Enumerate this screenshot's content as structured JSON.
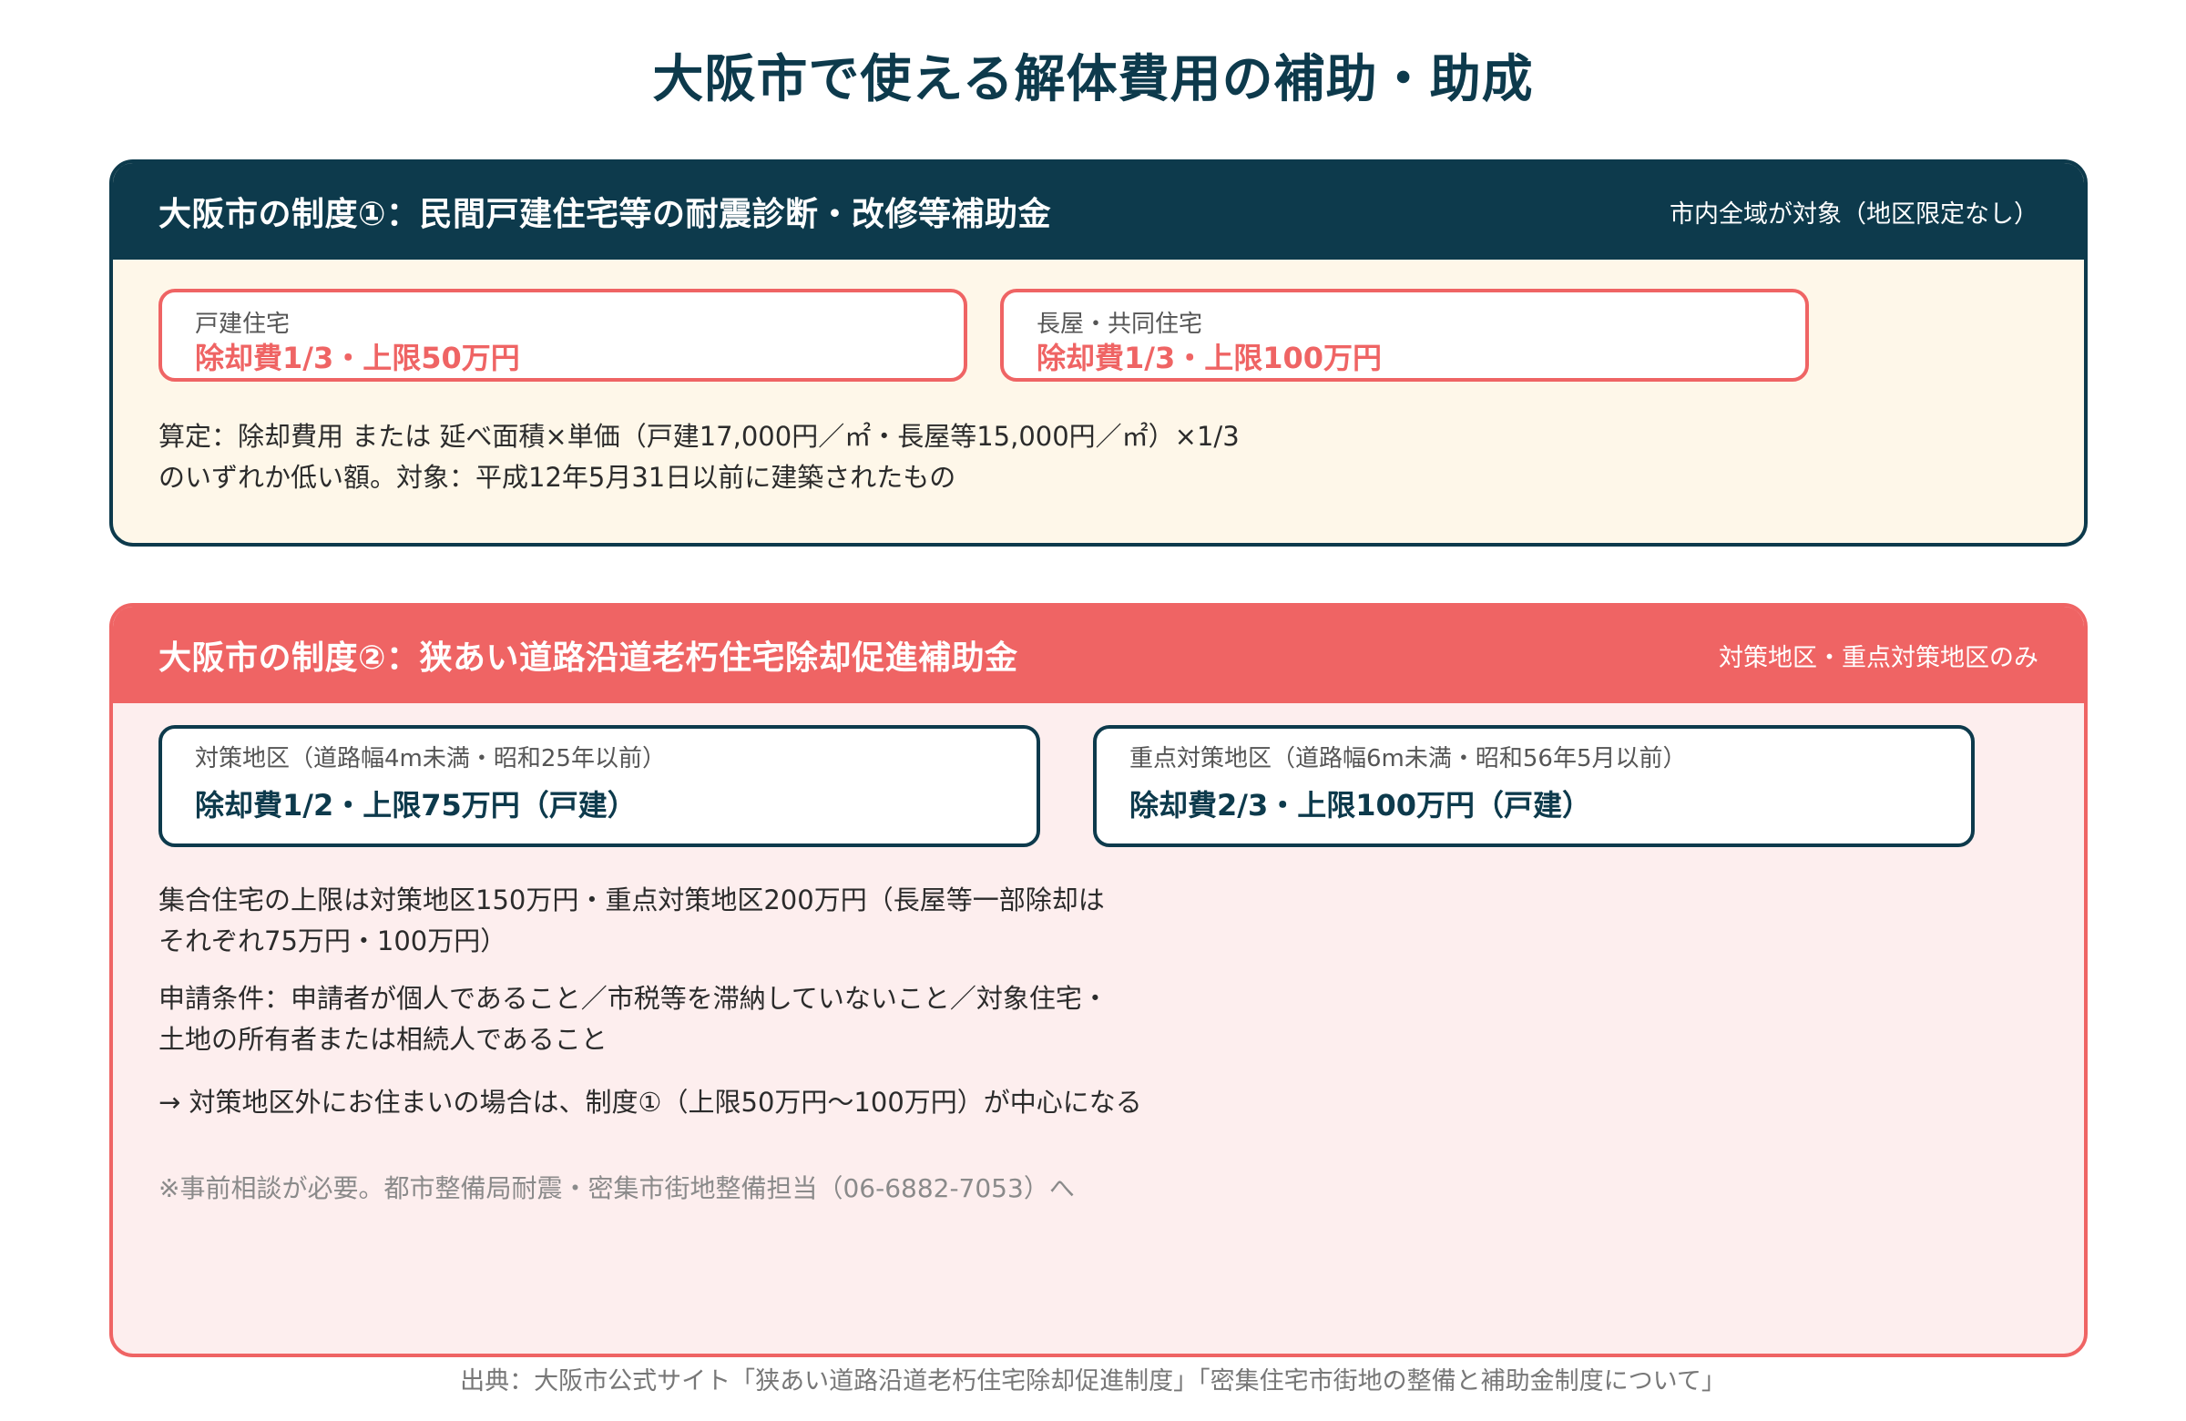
{
  "page": {
    "title": "大阪市で使える解体費用の補助・助成",
    "source": "出典：大阪市公式サイト「狭あい道路沿道老朽住宅除却促進制度」「密集住宅市街地の整備と補助金制度について」"
  },
  "colors": {
    "navy": "#0d3a4c",
    "coral": "#ef6464",
    "cream": "#fef7e9",
    "pink": "#fdeeee"
  },
  "system1": {
    "title": "大阪市の制度①：民間戸建住宅等の耐震診断・改修等補助金",
    "tag": "市内全域が対象（地区限定なし）",
    "boxes": [
      {
        "label": "戸建住宅",
        "value": "除却費1/3・上限50万円"
      },
      {
        "label": "長屋・共同住宅",
        "value": "除却費1/3・上限100万円"
      }
    ],
    "calc_line1": "算定：除却費用 または 延べ面積×単価（戸建17,000円／㎡・長屋等15,000円／㎡）×1/3",
    "calc_line2": "のいずれか低い額。対象：平成12年5月31日以前に建築されたもの"
  },
  "system2": {
    "title": "大阪市の制度②：狭あい道路沿道老朽住宅除却促進補助金",
    "tag": "対策地区・重点対策地区のみ",
    "boxes": [
      {
        "label": "対策地区（道路幅4m未満・昭和25年以前）",
        "value": "除却費1/2・上限75万円（戸建）"
      },
      {
        "label": "重点対策地区（道路幅6m未満・昭和56年5月以前）",
        "value": "除却費2/3・上限100万円（戸建）"
      }
    ],
    "para1_line1": "集合住宅の上限は対策地区150万円・重点対策地区200万円（長屋等一部除却は",
    "para1_line2": "それぞれ75万円・100万円）",
    "para2_line1": "申請条件：申請者が個人であること／市税等を滞納していないこと／対象住宅・",
    "para2_line2": "土地の所有者または相続人であること",
    "arrow_line": "→ 対策地区外にお住まいの場合は、制度①（上限50万円〜100万円）が中心になる",
    "note": "※事前相談が必要。都市整備局耐震・密集市街地整備担当（06-6882-7053）へ"
  }
}
